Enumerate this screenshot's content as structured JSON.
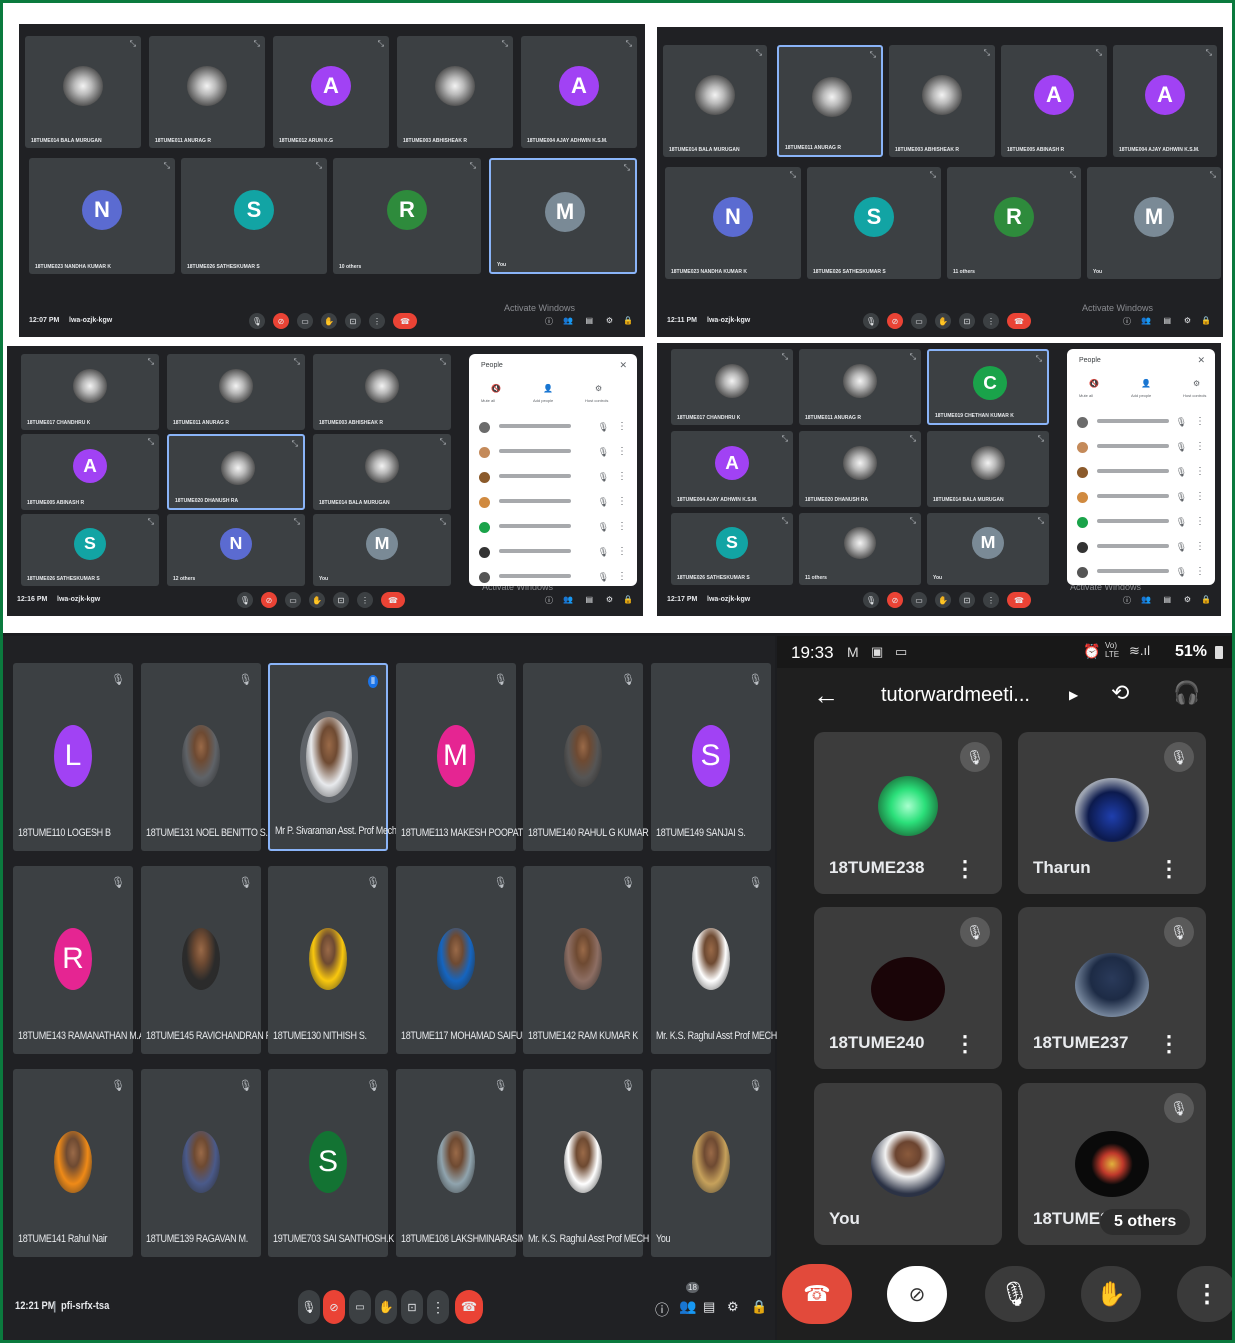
{
  "screens": {
    "s1": {
      "tiles": [
        {
          "name": "18TUME014 BALA MURUGAN",
          "initial": ""
        },
        {
          "name": "18TUME011 ANURAG R",
          "initial": ""
        },
        {
          "name": "18TUME012 ARUN K.G",
          "initial": "A"
        },
        {
          "name": "18TUME003 ABHISHEAK R",
          "initial": ""
        },
        {
          "name": "18TUME004 AJAY ADHWIN K.S.M.",
          "initial": "A"
        },
        {
          "name": "18TUME023 NANDHA KUMAR K",
          "initial": "N"
        },
        {
          "name": "18TUME026 SATHESKUMAR S",
          "initial": "S"
        },
        {
          "name": "10 others",
          "initial": "R"
        },
        {
          "name": "You",
          "initial": "M"
        }
      ],
      "time": "12:07 PM",
      "code": "lwa-ozjk-kgw",
      "activate": "Activate Windows"
    },
    "s2": {
      "tiles": [
        {
          "name": "18TUME014 BALA MURUGAN",
          "initial": ""
        },
        {
          "name": "18TUME011 ANURAG R",
          "initial": ""
        },
        {
          "name": "18TUME003 ABHISHEAK R",
          "initial": ""
        },
        {
          "name": "18TUME005 ABINASH R",
          "initial": "A"
        },
        {
          "name": "18TUME004 AJAY ADHWIN K.S.M.",
          "initial": "A"
        },
        {
          "name": "18TUME023 NANDHA KUMAR K",
          "initial": "N"
        },
        {
          "name": "18TUME026 SATHESKUMAR S",
          "initial": "S"
        },
        {
          "name": "11 others",
          "initial": "R"
        },
        {
          "name": "You",
          "initial": "M"
        }
      ],
      "time": "12:11 PM",
      "code": "lwa-ozjk-kgw",
      "activate": "Activate Windows"
    },
    "s3": {
      "tiles": [
        {
          "name": "18TUME017 CHANDHRU K",
          "initial": ""
        },
        {
          "name": "18TUME011 ANURAG R",
          "initial": ""
        },
        {
          "name": "18TUME003 ABHISHEAK R",
          "initial": ""
        },
        {
          "name": "18TUME005 ABINASH R",
          "initial": "A"
        },
        {
          "name": "18TUME020 DHANUSH RA",
          "initial": ""
        },
        {
          "name": "18TUME014 BALA MURUGAN",
          "initial": ""
        },
        {
          "name": "18TUME026 SATHESKUMAR S",
          "initial": "S"
        },
        {
          "name": "12 others",
          "initial": "N"
        },
        {
          "name": "You",
          "initial": "M"
        }
      ],
      "time": "12:16 PM",
      "code": "lwa-ozjk-kgw",
      "people_title": "People",
      "people_actions": [
        "Mute all",
        "Add people",
        "Host controls"
      ],
      "activate": "Activate Windows"
    },
    "s4": {
      "tiles": [
        {
          "name": "18TUME017 CHANDHRU K",
          "initial": ""
        },
        {
          "name": "18TUME011 ANURAG R",
          "initial": ""
        },
        {
          "name": "18TUME019 CHETHAN KUMAR K",
          "initial": "C"
        },
        {
          "name": "18TUME004 AJAY ADHWIN K.S.M.",
          "initial": "A"
        },
        {
          "name": "18TUME020 DHANUSH RA",
          "initial": ""
        },
        {
          "name": "18TUME014 BALA MURUGAN",
          "initial": ""
        },
        {
          "name": "18TUME026 SATHESKUMAR S",
          "initial": "S"
        },
        {
          "name": "11 others",
          "initial": ""
        },
        {
          "name": "You",
          "initial": "M"
        }
      ],
      "time": "12:17 PM",
      "code": "lwa-ozjk-kgw",
      "people_title": "People",
      "people_actions": [
        "Mute all",
        "Add people",
        "Host controls"
      ],
      "activate": "Activate Windows"
    }
  },
  "big": {
    "tiles": [
      {
        "name": "18TUME110 LOGESH B",
        "initial": "L",
        "color": "#a142f4"
      },
      {
        "name": "18TUME131 NOEL BENITTO S.",
        "initial": "",
        "color": "#5f6368"
      },
      {
        "name": "Mr P. Sivaraman Asst. Prof Mech",
        "initial": "",
        "color": "#e8eaed"
      },
      {
        "name": "18TUME113 MAKESH POOPATH...",
        "initial": "M",
        "color": "#e52592"
      },
      {
        "name": "18TUME140 RAHUL G KUMAR",
        "initial": "",
        "color": "#555"
      },
      {
        "name": "18TUME149 SANJAI S.",
        "initial": "S",
        "color": "#a142f4"
      },
      {
        "name": "18TUME143 RAMANATHAN M.A.",
        "initial": "R",
        "color": "#e52592"
      },
      {
        "name": "18TUME145 RAVICHANDRAN R",
        "initial": "",
        "color": "#2b2b2b"
      },
      {
        "name": "18TUME130 NITHISH S.",
        "initial": "",
        "color": "#f9c80e"
      },
      {
        "name": "18TUME117 MOHAMAD SAIFUD...",
        "initial": "",
        "color": "#1565c0"
      },
      {
        "name": "18TUME142 RAM KUMAR K",
        "initial": "",
        "color": "#8d6e63"
      },
      {
        "name": "Mr. K.S. Raghul Asst Prof MECH",
        "initial": "",
        "color": "#ffffff"
      },
      {
        "name": "18TUME141 Rahul Nair",
        "initial": "",
        "color": "#ef8a17"
      },
      {
        "name": "18TUME139 RAGAVAN M.",
        "initial": "",
        "color": "#4a5a8a"
      },
      {
        "name": "19TUME703 SAI SANTHOSH.K",
        "initial": "S",
        "color": "#137333"
      },
      {
        "name": "18TUME108 LAKSHMINARASIM...",
        "initial": "",
        "color": "#90a4ae"
      },
      {
        "name": "Mr. K.S. Raghul Asst Prof MECH",
        "initial": "",
        "color": "#ffffff"
      },
      {
        "name": "You",
        "initial": "",
        "color": "#c6a15b"
      }
    ],
    "time": "12:21 PM",
    "code": "pfi-srfx-tsa",
    "people_count": "18"
  },
  "phone": {
    "status_time": "19:33",
    "battery": "51%",
    "network": "Vo) LTE",
    "meeting_title": "tutorwardmeeti...",
    "tiles": [
      {
        "name": "18TUME238"
      },
      {
        "name": "Tharun"
      },
      {
        "name": "18TUME240"
      },
      {
        "name": "18TUME237"
      },
      {
        "name": "You"
      },
      {
        "name": "18TUME2"
      }
    ],
    "others_chip": "5 others"
  }
}
